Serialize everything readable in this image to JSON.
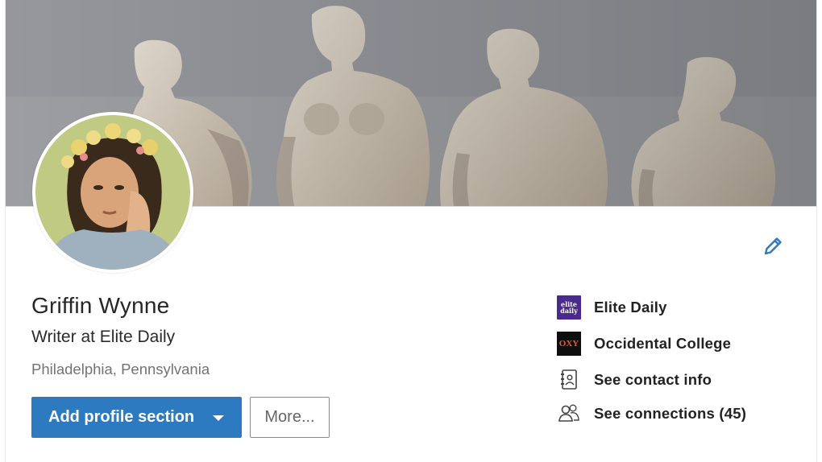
{
  "profile": {
    "name": "Griffin Wynne",
    "headline": "Writer at Elite Daily",
    "location": "Philadelphia, Pennsylvania"
  },
  "actions": {
    "add_section_label": "Add profile section",
    "more_label": "More..."
  },
  "sidebar": {
    "items": [
      {
        "label": "Elite Daily",
        "icon": "elite-daily-logo",
        "logo_text": "elite daily"
      },
      {
        "label": "Occidental College",
        "icon": "occidental-logo",
        "logo_text": "OXY"
      },
      {
        "label": "See contact info",
        "icon": "contact-card-icon"
      },
      {
        "label": "See connections (45)",
        "icon": "people-icon"
      }
    ]
  },
  "colors": {
    "primary": "#2d7ac0",
    "edit_icon": "#2d7ac0",
    "text": "#262626",
    "muted": "#737373"
  }
}
